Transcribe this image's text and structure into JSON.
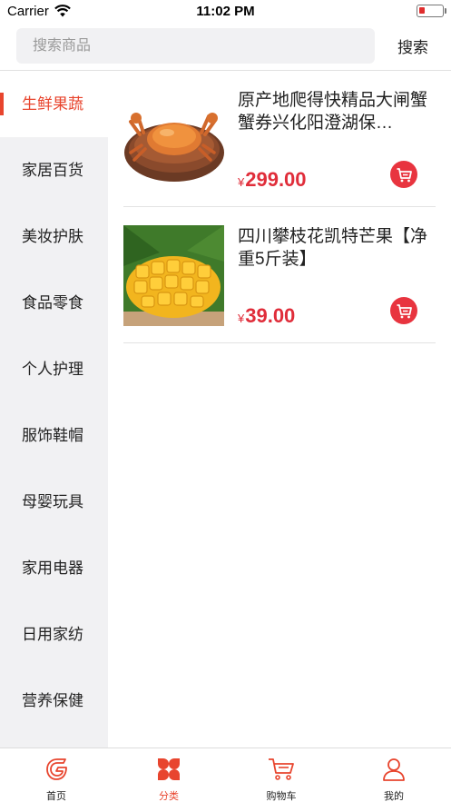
{
  "status_bar": {
    "carrier": "Carrier",
    "time": "11:02 PM"
  },
  "search": {
    "placeholder": "搜索商品",
    "button_label": "搜索"
  },
  "sidebar": {
    "active_index": 0,
    "items": [
      {
        "label": "生鲜果蔬"
      },
      {
        "label": "家居百货"
      },
      {
        "label": "美妆护肤"
      },
      {
        "label": "食品零食"
      },
      {
        "label": "个人护理"
      },
      {
        "label": "服饰鞋帽"
      },
      {
        "label": "母婴玩具"
      },
      {
        "label": "家用电器"
      },
      {
        "label": "日用家纺"
      },
      {
        "label": "营养保健"
      }
    ]
  },
  "products": [
    {
      "title": "原产地爬得快精品大闸蟹蟹券兴化阳澄湖保…",
      "currency": "¥",
      "price": "299.00",
      "image": "crab-photo"
    },
    {
      "title": "四川攀枝花凯特芒果【净重5斤装】",
      "currency": "¥",
      "price": "39.00",
      "image": "mango-photo"
    }
  ],
  "tabbar": {
    "active_index": 1,
    "tabs": [
      {
        "label": "首页",
        "icon": "home-icon"
      },
      {
        "label": "分类",
        "icon": "category-icon"
      },
      {
        "label": "购物车",
        "icon": "cart-icon"
      },
      {
        "label": "我的",
        "icon": "profile-icon"
      }
    ]
  },
  "colors": {
    "accent": "#e8452e",
    "price": "#e02d3a",
    "sidebar_bg": "#f1f1f3"
  }
}
